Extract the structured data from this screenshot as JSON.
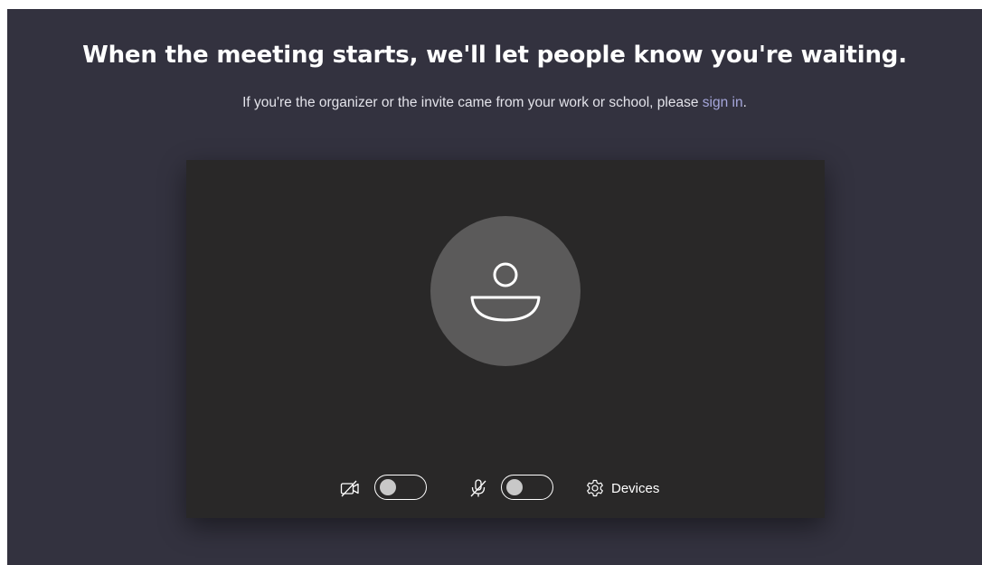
{
  "prejoin": {
    "headline": "When the meeting starts, we'll let people know you're waiting.",
    "subline_prefix": "If you're the organizer or the invite came from your work or school, please ",
    "sign_in_label": "sign in",
    "subline_suffix": ".",
    "accent_link_color": "#a6a7dc"
  },
  "preview": {
    "avatar_icon": "person-icon",
    "background_color": "#292828"
  },
  "controls": {
    "camera": {
      "icon": "camera-off-icon",
      "on": false
    },
    "microphone": {
      "icon": "mic-off-icon",
      "on": false
    },
    "devices": {
      "icon": "gear-icon",
      "label": "Devices"
    }
  }
}
